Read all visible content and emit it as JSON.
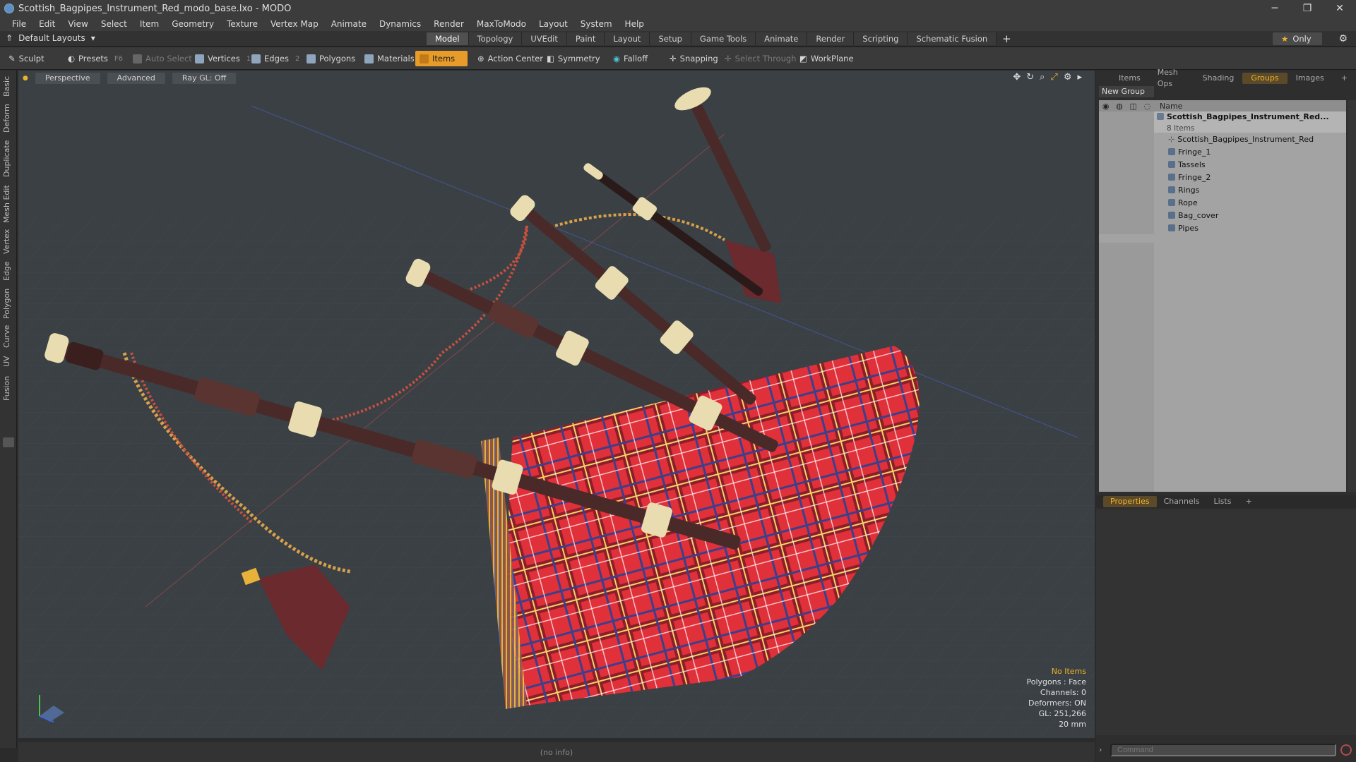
{
  "window": {
    "title": "Scottish_Bagpipes_Instrument_Red_modo_base.lxo - MODO",
    "minimize": "─",
    "maximize": "❐",
    "close": "✕"
  },
  "menu": [
    "File",
    "Edit",
    "View",
    "Select",
    "Item",
    "Geometry",
    "Texture",
    "Vertex Map",
    "Animate",
    "Dynamics",
    "Render",
    "MaxToModo",
    "Layout",
    "System",
    "Help"
  ],
  "layout": {
    "dropdown": "Default Layouts",
    "tabs": [
      "Model",
      "Topology",
      "UVEdit",
      "Paint",
      "Layout",
      "Setup",
      "Game Tools",
      "Animate",
      "Render",
      "Scripting",
      "Schematic Fusion"
    ],
    "active_tab": "Model",
    "add": "+",
    "only": "Only"
  },
  "toolbar": {
    "sculpt": "Sculpt",
    "presets": "Presets",
    "presets_key": "F6",
    "auto_select": "Auto Select",
    "vertices": "Vertices",
    "vertices_key": "1",
    "edges": "Edges",
    "edges_key": "2",
    "polygons": "Polygons",
    "materials": "Materials",
    "items": "Items",
    "action_center": "Action Center",
    "symmetry": "Symmetry",
    "falloff": "Falloff",
    "snapping": "Snapping",
    "select_through": "Select Through",
    "workplane": "WorkPlane"
  },
  "left_tabs": [
    "Basic",
    "Deform",
    "Duplicate",
    "Mesh Edit",
    "Vertex",
    "Edge",
    "Polygon",
    "Curve",
    "UV",
    "Fusion"
  ],
  "viewport": {
    "view": "Perspective",
    "shading": "Advanced",
    "raygl": "Ray GL: Off",
    "info": {
      "no_items": "No Items",
      "polygons": "Polygons : Face",
      "channels": "Channels: 0",
      "deformers": "Deformers: ON",
      "gl": "GL: 251,266",
      "scale": "20 mm"
    }
  },
  "status": "(no info)",
  "right_panel": {
    "tabs": [
      "Items",
      "Mesh Ops",
      "Shading",
      "Groups",
      "Images"
    ],
    "active_tab": "Groups",
    "new_group": "New Group",
    "name_col": "Name",
    "group": {
      "name": "Scottish_Bagpipes_Instrument_Red...",
      "count": "8 Items"
    },
    "items": [
      "Scottish_Bagpipes_Instrument_Red",
      "Fringe_1",
      "Tassels",
      "Fringe_2",
      "Rings",
      "Rope",
      "Bag_cover",
      "Pipes"
    ],
    "prop_tabs": [
      "Properties",
      "Channels",
      "Lists"
    ],
    "active_prop_tab": "Properties",
    "command_placeholder": "Command"
  },
  "colors": {
    "accent": "#e79c2a",
    "tartan_red": "#e0303a",
    "wood": "#4a2a28",
    "ivory": "#e8dcb0"
  }
}
